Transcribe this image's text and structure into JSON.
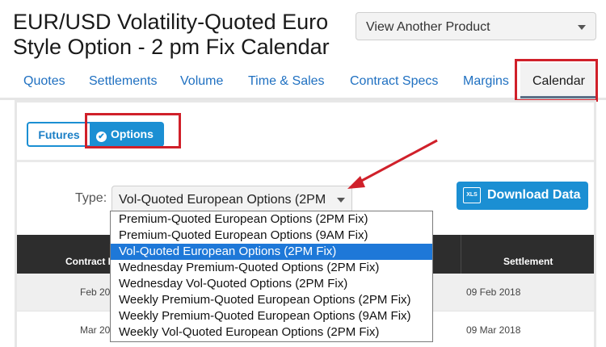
{
  "header": {
    "title_line1": "EUR/USD Volatility-Quoted Euro",
    "title_line2": "Style Option - 2 pm Fix Calendar",
    "product_select": "View Another Product"
  },
  "tabs": [
    {
      "label": "Quotes"
    },
    {
      "label": "Settlements"
    },
    {
      "label": "Volume"
    },
    {
      "label": "Time & Sales"
    },
    {
      "label": "Contract Specs"
    },
    {
      "label": "Margins"
    },
    {
      "label": "Calendar",
      "active": true
    }
  ],
  "toggle": {
    "futures_label": "Futures",
    "options_label": "Options"
  },
  "filter": {
    "type_label": "Type:",
    "type_value": "Vol-Quoted European Options (2PM",
    "download_label": "Download Data",
    "download_icon_text": "XLS"
  },
  "table": {
    "headers": [
      "Contract I",
      "Settlement"
    ],
    "rows": [
      {
        "contract": "Feb 20",
        "settlement": "09 Feb 2018"
      },
      {
        "contract": "Mar 20",
        "settlement": "09 Mar 2018"
      }
    ]
  },
  "dropdown_options": [
    "Premium-Quoted European Options (2PM Fix)",
    "Premium-Quoted European Options (9AM Fix)",
    "Vol-Quoted European Options (2PM Fix)",
    "Wednesday Premium-Quoted Options (2PM Fix)",
    "Wednesday Vol-Quoted Options (2PM Fix)",
    "Weekly Premium-Quoted European Options (2PM Fix)",
    "Weekly Premium-Quoted European Options (9AM Fix)",
    "Weekly Vol-Quoted European Options (2PM Fix)"
  ],
  "colors": {
    "accent": "#1b8fd3",
    "link": "#1f70c1",
    "highlight_box": "#d0202a",
    "selected_option": "#1e78d8",
    "table_header": "#2d2d2d"
  },
  "icons": [
    "chevron-down-icon",
    "check-circle-icon",
    "xls-file-icon",
    "arrow-annotation"
  ]
}
